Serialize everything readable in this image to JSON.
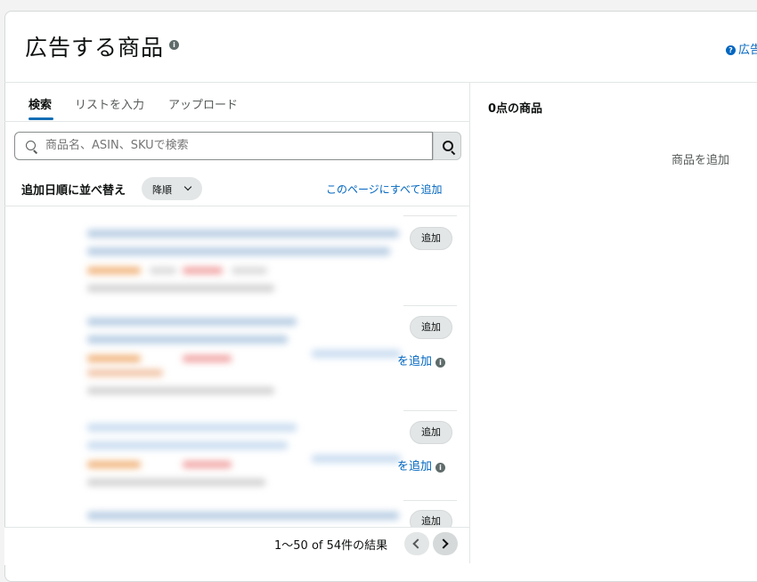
{
  "header": {
    "title": "広告する商品",
    "info_icon": "info-icon",
    "help_link": "広告"
  },
  "tabs": [
    {
      "label": "検索",
      "active": true
    },
    {
      "label": "リストを入力",
      "active": false
    },
    {
      "label": "アップロード",
      "active": false
    }
  ],
  "search": {
    "placeholder": "商品名、ASIN、SKUで検索",
    "value": ""
  },
  "sort": {
    "label": "追加日順に並べ替え",
    "order": "降順",
    "add_all": "このページにすべて追加"
  },
  "items": [
    {
      "add_label": "追加",
      "variant_link": ""
    },
    {
      "add_label": "追加",
      "variant_link": "を追加"
    },
    {
      "add_label": "追加",
      "variant_link": "を追加"
    },
    {
      "add_label": "追加",
      "variant_link": ""
    }
  ],
  "pagination": {
    "results": "1〜50 of 54件の結果"
  },
  "selected": {
    "count_label": "0点の商品",
    "empty_label": "商品を追加"
  },
  "colors": {
    "link": "#0066c0",
    "tab_accent": "#146eb4",
    "button_bg": "#e3e6e6"
  }
}
